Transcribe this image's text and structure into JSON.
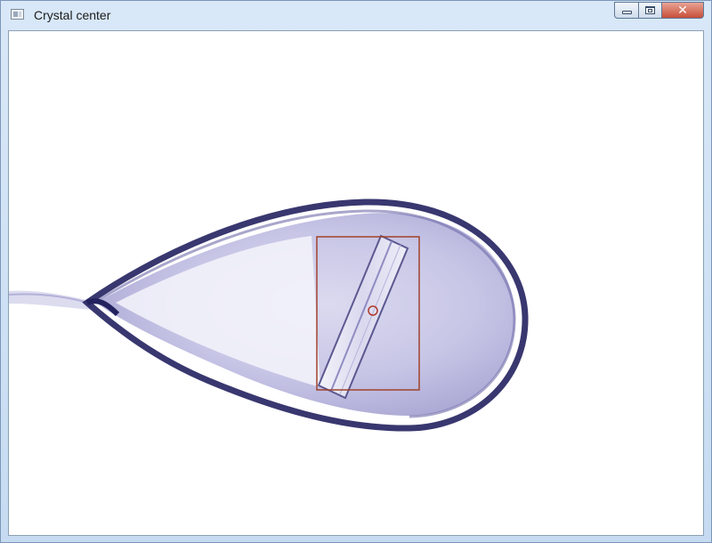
{
  "window": {
    "title": "Crystal center",
    "icon": "app-window-icon"
  },
  "controls": {
    "minimize_icon": "minimize-icon",
    "maximize_icon": "maximize-icon",
    "close_glyph": "✕"
  },
  "camera_view": {
    "subject": "crystal-in-loop",
    "bounding_box_color": "#a0432c",
    "center_marker_color": "#b0392b",
    "loop_color": "#24215f"
  }
}
